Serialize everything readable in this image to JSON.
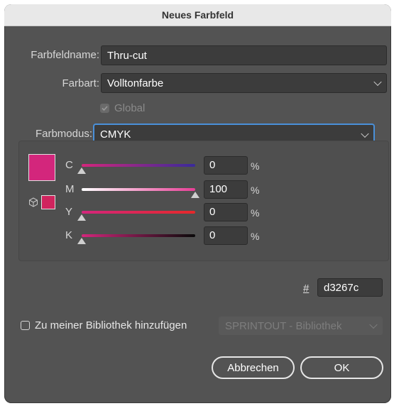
{
  "title": "Neues Farbfeld",
  "swatch_name": {
    "label": "Farbfeldname:",
    "value": "Thru-cut"
  },
  "color_type": {
    "label": "Farbart:",
    "value": "Volltonfarbe"
  },
  "global": {
    "label": "Global",
    "checked": true,
    "disabled": true
  },
  "color_mode": {
    "label": "Farbmodus:",
    "value": "CMYK"
  },
  "swatch_color": "#d3267c",
  "gamut_color": "#d0245e",
  "sliders": [
    {
      "channel": "C",
      "value": "0",
      "unit": "%",
      "level": 0
    },
    {
      "channel": "M",
      "value": "100",
      "unit": "%",
      "level": 100
    },
    {
      "channel": "Y",
      "value": "0",
      "unit": "%",
      "level": 0
    },
    {
      "channel": "K",
      "value": "0",
      "unit": "%",
      "level": 0
    }
  ],
  "hex": {
    "symbol": "#",
    "value": "d3267c"
  },
  "library": {
    "label": "Zu meiner Bibliothek hinzufügen",
    "checked": false,
    "select_value": "SPRINTOUT - Bibliothek"
  },
  "buttons": {
    "cancel": "Abbrechen",
    "ok": "OK"
  },
  "icons": {
    "gamut": "cube-icon"
  }
}
